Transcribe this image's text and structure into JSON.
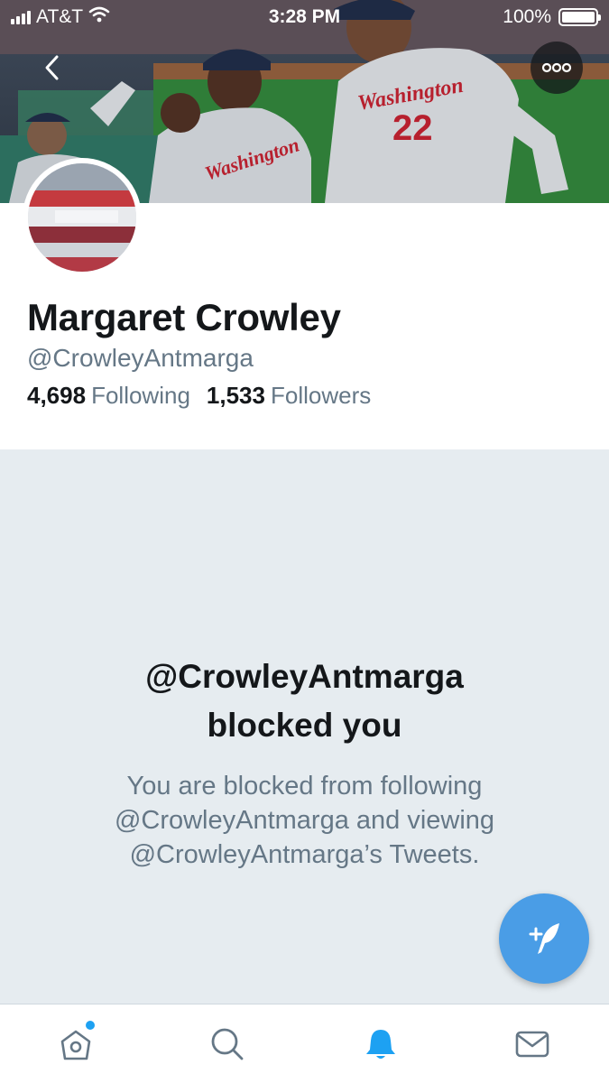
{
  "status_bar": {
    "carrier": "AT&T",
    "time": "3:28 PM",
    "battery_percent": "100%",
    "battery_level": 1.0
  },
  "header": {
    "banner_image": "baseball players celebrating in Washington jerseys",
    "jersey_lettering": "Washington",
    "back_icon": "chevron-left-icon",
    "more_icon": "ellipsis-icon"
  },
  "profile": {
    "name": "Margaret Crowley",
    "handle": "@CrowleyAntmarga",
    "following_count": "4,698",
    "following_label": "Following",
    "followers_count": "1,533",
    "followers_label": "Followers",
    "avatar_image": "stadium crowd photo"
  },
  "blocked": {
    "title_line1": "@CrowleyAntmarga",
    "title_line2": "blocked you",
    "message_line1": "You are blocked from following",
    "message_line2": "@CrowleyAntmarga and viewing",
    "message_line3": "@CrowleyAntmarga’s Tweets."
  },
  "compose_button": {
    "icon": "compose-tweet-icon"
  },
  "tab_bar": {
    "tabs": [
      {
        "name": "home",
        "icon": "home-icon",
        "active": false,
        "has_new": true
      },
      {
        "name": "search",
        "icon": "search-icon",
        "active": false,
        "has_new": false
      },
      {
        "name": "notifications",
        "icon": "bell-icon",
        "active": true,
        "has_new": false
      },
      {
        "name": "messages",
        "icon": "envelope-icon",
        "active": false,
        "has_new": false
      }
    ]
  },
  "colors": {
    "accent": "#1da1f2",
    "fab": "#4a9de6",
    "text_primary": "#14171a",
    "text_secondary": "#657786",
    "blocked_background": "#e6ecf0",
    "icon_inactive": "#657786"
  }
}
